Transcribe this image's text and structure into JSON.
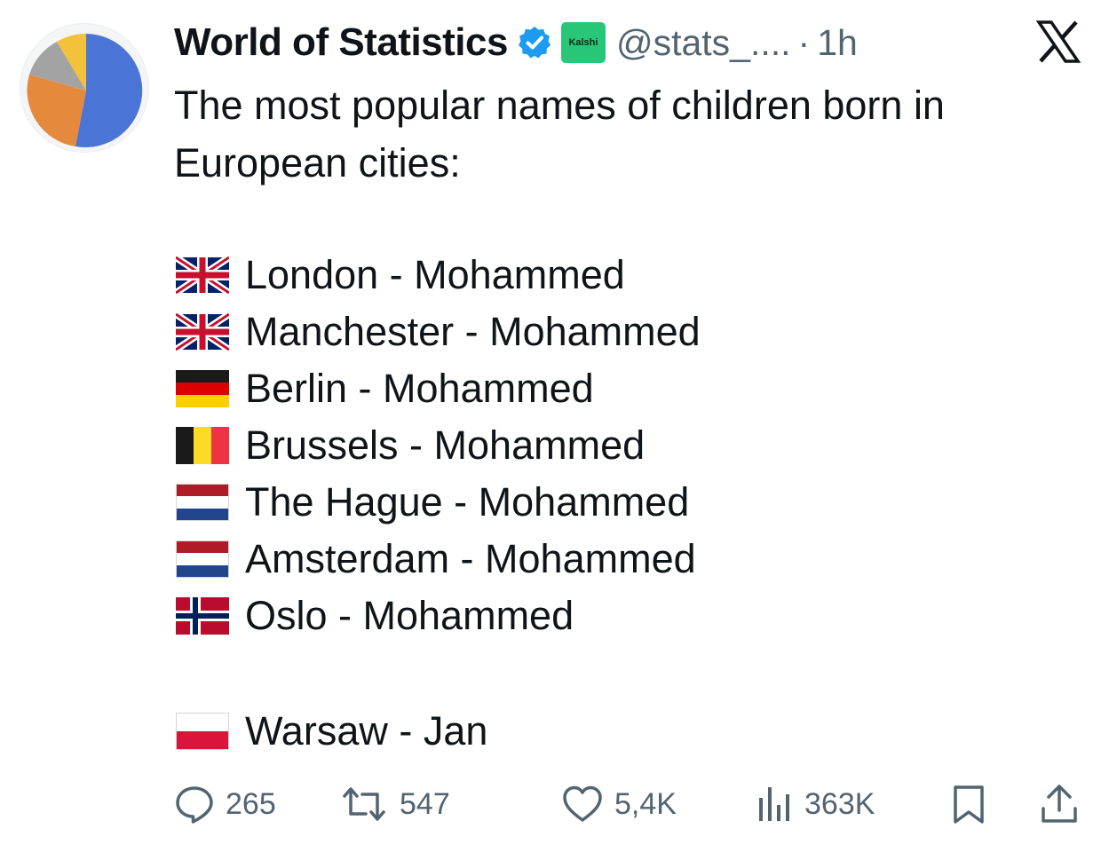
{
  "header": {
    "display_name": "World of Statistics",
    "affiliate_badge": "Kalshi",
    "handle": "@stats_....",
    "separator": "·",
    "time": "1h"
  },
  "icons": {
    "avatar": "pie-chart-avatar-icon",
    "verified": "verified-badge-icon",
    "x_logo": "x-logo-icon",
    "reply": "reply-icon",
    "retweet": "retweet-icon",
    "like": "heart-icon",
    "views": "views-bar-chart-icon",
    "bookmark": "bookmark-icon",
    "share": "share-icon"
  },
  "tweet": {
    "intro_line1": "The most popular names of children born in",
    "intro_line2": "European cities:",
    "entries": [
      {
        "flag": "uk-flag-icon",
        "text": "London - Mohammed"
      },
      {
        "flag": "uk-flag-icon",
        "text": "Manchester - Mohammed"
      },
      {
        "flag": "germany-flag-icon",
        "text": "Berlin - Mohammed"
      },
      {
        "flag": "belgium-flag-icon",
        "text": "Brussels - Mohammed"
      },
      {
        "flag": "netherlands-flag-icon",
        "text": "The Hague - Mohammed"
      },
      {
        "flag": "netherlands-flag-icon",
        "text": "Amsterdam - Mohammed"
      },
      {
        "flag": "norway-flag-icon",
        "text": "Oslo - Mohammed"
      },
      {
        "flag": "poland-flag-icon",
        "text": "Warsaw - Jan"
      }
    ]
  },
  "actions": {
    "replies": "265",
    "retweets": "547",
    "likes": "5,4K",
    "views": "363K"
  },
  "colors": {
    "text": "#0f1419",
    "muted": "#536471",
    "verified_blue": "#1d9bf0",
    "kalshi_green": "#27c777"
  }
}
